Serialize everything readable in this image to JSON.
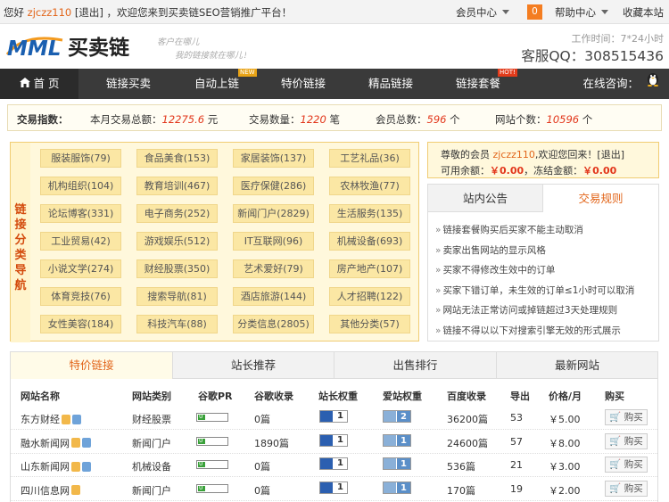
{
  "topbar": {
    "greeting": "您好",
    "username": "zjczz110",
    "logout": "[退出]",
    "welcome": "，欢迎您来到买卖链SEO营销推广平台！",
    "member_center": "会员中心",
    "notice_count": "0",
    "help_center": "帮助中心",
    "favorite": "收藏本站"
  },
  "header": {
    "logo_mark": "MML",
    "logo_text": "买卖链",
    "slogan_1": "客户在哪儿",
    "slogan_2": "我的链接就在哪儿！",
    "work_time": "工作时间：7*24小时",
    "qq": "客服QQ：308515436"
  },
  "nav": {
    "items": [
      {
        "label": "首 页"
      },
      {
        "label": "链接买卖"
      },
      {
        "label": "自动上链",
        "badge": "NEW"
      },
      {
        "label": "特价链接"
      },
      {
        "label": "精品链接"
      },
      {
        "label": "链接套餐",
        "badge": "HOT!"
      }
    ],
    "consult": "在线咨询："
  },
  "stats": {
    "index_label": "交易指数：",
    "month_total_label": "本月交易总额：",
    "month_total": "12275.6",
    "month_total_unit": "元",
    "trade_count_label": "交易数量：",
    "trade_count": "1220",
    "trade_count_unit": "笔",
    "members_label": "会员总数：",
    "members": "596",
    "members_unit": "个",
    "sites_label": "网站个数：",
    "sites": "10596",
    "sites_unit": "个"
  },
  "categories": {
    "side_label": [
      "链",
      "接",
      "分",
      "类",
      "导",
      "航"
    ],
    "items": [
      "服装服饰(79)",
      "食品美食(153)",
      "家居装饰(137)",
      "工艺礼品(36)",
      "机构组织(104)",
      "教育培训(467)",
      "医疗保健(286)",
      "农林牧渔(77)",
      "论坛博客(331)",
      "电子商务(252)",
      "新闻门户(2829)",
      "生活服务(135)",
      "工业贸易(42)",
      "游戏娱乐(512)",
      "IT互联网(96)",
      "机械设备(693)",
      "小说文学(274)",
      "财经股票(350)",
      "艺术爱好(79)",
      "房产地产(107)",
      "体育竞技(76)",
      "搜索导航(81)",
      "酒店旅游(144)",
      "人才招聘(122)",
      "女性美容(184)",
      "科技汽车(88)",
      "分类信息(2805)",
      "其他分类(57)"
    ]
  },
  "member": {
    "dear": "尊敬的会员",
    "username": "zjczz110",
    "welcome_back": "欢迎您回来！",
    "logout": "[退出]",
    "available_label": "可用余额：",
    "available": "￥0.00",
    "frozen_label": "，冻结金额：",
    "frozen": "￥0.00"
  },
  "notice": {
    "tab_announce": "站内公告",
    "tab_rules": "交易规则",
    "items": [
      "链接套餐购买后买家不能主动取消",
      "卖家出售网站的显示风格",
      "买家不得修改生效中的订单",
      "买家下错订单，未生效的订单≤1小时可以取消",
      "网站无法正常访问或掉链超过3天处理规则",
      "链接不得以以下对搜索引擎无效的形式展示"
    ]
  },
  "table": {
    "tabs": [
      "特价链接",
      "站长推荐",
      "出售排行",
      "最新网站"
    ],
    "headers": [
      "网站名称",
      "网站类别",
      "谷歌PR",
      "谷歌收录",
      "站长权重",
      "爱站权重",
      "百度收录",
      "导出",
      "价格/月",
      "购买"
    ],
    "buy_label": "购买",
    "rows": [
      {
        "name": "东方财经",
        "icons": [
          "yellow",
          "blue"
        ],
        "category": "财经股票",
        "pr": "0",
        "google": "0篇",
        "zz": "1",
        "az": "2",
        "baidu": "36200篇",
        "out": "53",
        "price": "￥5.00"
      },
      {
        "name": "融水新闻网",
        "icons": [
          "yellow",
          "blue"
        ],
        "category": "新闻门户",
        "pr": "0",
        "google": "1890篇",
        "zz": "1",
        "az": "1",
        "baidu": "24600篇",
        "out": "57",
        "price": "￥8.00"
      },
      {
        "name": "山东新闻网",
        "icons": [
          "yellow",
          "blue"
        ],
        "category": "机械设备",
        "pr": "0",
        "google": "0篇",
        "zz": "1",
        "az": "1",
        "baidu": "536篇",
        "out": "21",
        "price": "￥3.00"
      },
      {
        "name": "四川信息网",
        "icons": [
          "yellow"
        ],
        "category": "新闻门户",
        "pr": "0",
        "google": "0篇",
        "zz": "1",
        "az": "1",
        "baidu": "170篇",
        "out": "19",
        "price": "￥2.00"
      }
    ]
  },
  "colors": {
    "accent": "#e2661b",
    "nav_bg": "#3a3a3a",
    "panel_border": "#f0cc73",
    "panel_bg": "#fff8dc",
    "category_button": "#fbe7a4"
  }
}
